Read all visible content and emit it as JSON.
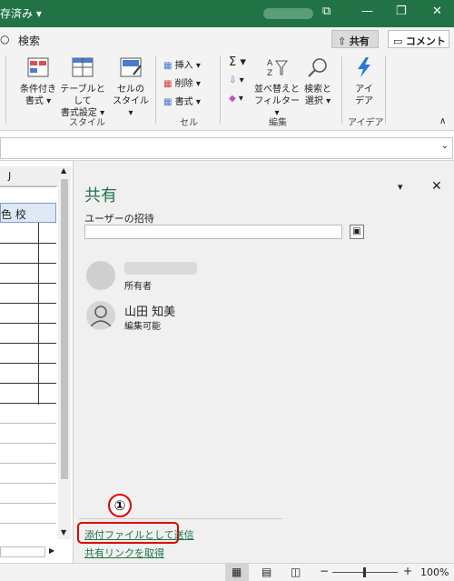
{
  "title_bar": {
    "title_fragment": "存済み ▾",
    "restore_icon": "❐"
  },
  "menu": {
    "search_label": "検索",
    "share_button": "共有",
    "comment_button": "コメント"
  },
  "ribbon": {
    "conditional_format": [
      "条件付き",
      "書式 ▾"
    ],
    "table_format": [
      "テーブルとして",
      "書式設定 ▾"
    ],
    "cell_style": [
      "セルの",
      "スタイル ▾"
    ],
    "style_group": "スタイル",
    "insert": "挿入",
    "delete": "削除",
    "format": "書式",
    "cells_group": "セル",
    "sort_filter": [
      "並べ替えと",
      "フィルター ▾"
    ],
    "find_select": [
      "検索と",
      "選択 ▾"
    ],
    "edit_group": "編集",
    "ideas": [
      "アイ",
      "デア"
    ],
    "ideas_group": "アイデア"
  },
  "grid": {
    "column_header": "J",
    "cell_text": "色 校"
  },
  "share_pane": {
    "title": "共有",
    "invite_label": "ユーザーの招待",
    "owner_role": "所有者",
    "user_name": "山田 知美",
    "user_role": "編集可能",
    "step_marker": "①",
    "send_attachment_link": "添付ファイルとして送信",
    "get_link": "共有リンクを取得"
  },
  "status_bar": {
    "zoom": "100%"
  },
  "colors": {
    "accent": "#217346",
    "highlight": "#e00000"
  }
}
